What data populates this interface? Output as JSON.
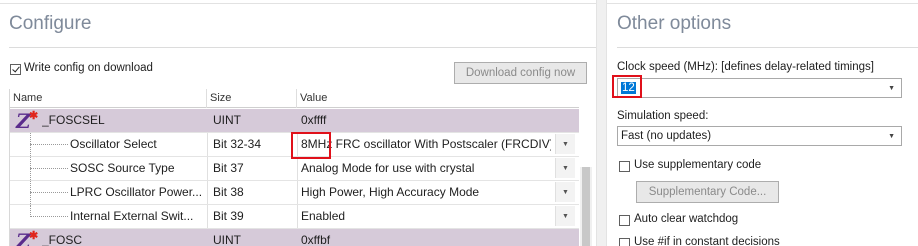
{
  "configure": {
    "title": "Configure",
    "write_config_label": "Write config on download",
    "write_config_checked": true,
    "download_button": "Download config now",
    "columns": [
      "Name",
      "Size",
      "Value"
    ],
    "rows": [
      {
        "type": "group",
        "name": "_FOSCSEL",
        "size": "UINT",
        "value": "0xffff"
      },
      {
        "type": "child",
        "name": "Oscillator Select",
        "size": "Bit 32-34",
        "value_highlight": "8MHz",
        "value_rest": " FRC oscillator With Postscaler (FRCDIV)"
      },
      {
        "type": "child",
        "name": "SOSC Source Type",
        "size": "Bit 37",
        "value": "Analog Mode for use with crystal"
      },
      {
        "type": "child",
        "name": "LPRC Oscillator Power...",
        "size": "Bit 38",
        "value": "High Power, High Accuracy Mode"
      },
      {
        "type": "child",
        "name": "Internal External Swit...",
        "size": "Bit 39",
        "value": "Enabled"
      },
      {
        "type": "group",
        "name": "_FOSC",
        "size": "UINT",
        "value": "0xffbf"
      }
    ]
  },
  "other": {
    "title": "Other options",
    "clock_label": "Clock speed (MHz): [defines delay-related timings]",
    "clock_value": "12",
    "sim_label": "Simulation speed:",
    "sim_value": "Fast (no updates)",
    "supplementary_label": "Use supplementary code",
    "supplementary_button": "Supplementary Code...",
    "watchdog_label": "Auto clear watchdog",
    "constant_label": "Use #if in constant decisions"
  },
  "colors": {
    "group_row": "#d6cad9",
    "title": "#7f8a9a",
    "highlight_box": "#e0101a",
    "selection": "#0078d7"
  },
  "icons": {
    "group_icon": "z-star-icon",
    "dropdown": "chevron-down-icon"
  }
}
